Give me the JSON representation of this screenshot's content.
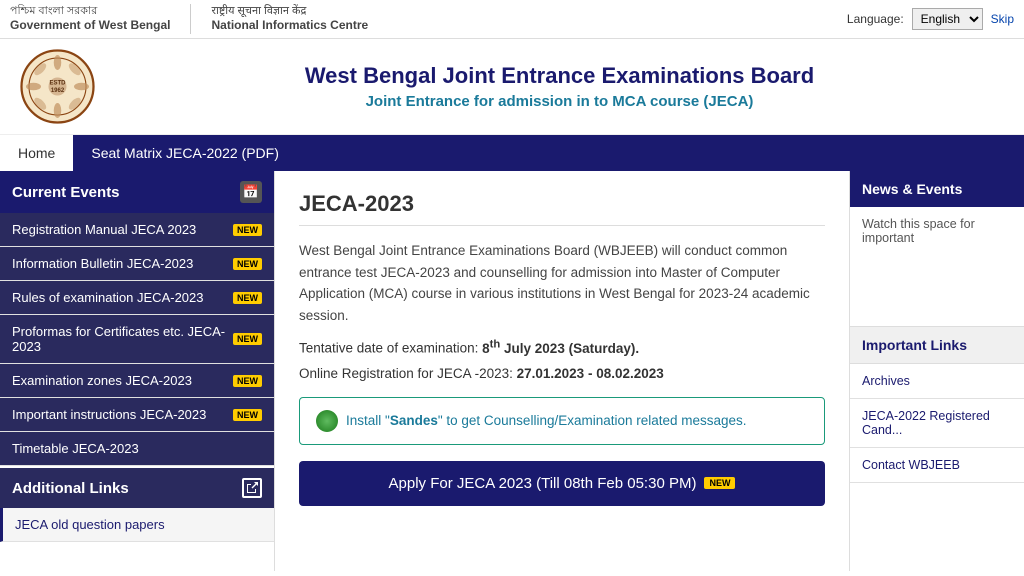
{
  "govBar": {
    "org1": {
      "line1": "পশ্চিম বাংলা সরকার",
      "line2": "Government of West Bengal"
    },
    "org2": {
      "line1": "राष्ट्रीय सूचना विज्ञान केंद्र",
      "line2": "National Informatics Centre"
    },
    "languageLabel": "Language:",
    "languageValue": "English",
    "skipLabel": "Skip"
  },
  "header": {
    "title": "West Bengal Joint Entrance Examinations Board",
    "subtitle": "Joint Entrance for admission in to MCA course (JECA)"
  },
  "nav": {
    "items": [
      {
        "label": "Home",
        "active": true
      },
      {
        "label": "Seat Matrix JECA-2022 (PDF)",
        "active": false
      }
    ]
  },
  "sidebar": {
    "currentEventsLabel": "Current Events",
    "items": [
      {
        "label": "Registration Manual JECA 2023",
        "hasNew": true
      },
      {
        "label": "Information Bulletin JECA-2023",
        "hasNew": true
      },
      {
        "label": "Rules of examination JECA-2023",
        "hasNew": true
      },
      {
        "label": "Proformas for Certificates etc. JECA-2023",
        "hasNew": true
      },
      {
        "label": "Examination zones JECA-2023",
        "hasNew": true
      },
      {
        "label": "Important instructions JECA-2023",
        "hasNew": true
      },
      {
        "label": "Timetable JECA-2023",
        "hasNew": false
      }
    ],
    "newBadgeText": "NEW"
  },
  "additionalLinks": {
    "label": "Additional Links",
    "items": [
      {
        "label": "JECA old question papers"
      }
    ]
  },
  "mainContent": {
    "title": "JECA-2023",
    "body": "West Bengal Joint Entrance Examinations Board (WBJEEB) will conduct common entrance test JECA-2023 and counselling for admission into Master of Computer Application (MCA) course in various institutions in West Bengal for 2023-24 academic session.",
    "tentativeLabel": "Tentative date of examination:",
    "tentativeDate": "8",
    "tentativeDateSuperscript": "th",
    "tentativeDateSuffix": " July 2023 (Saturday).",
    "registrationLabel": "Online Registration for JECA -2023:",
    "registrationDates": "27.01.2023 - 08.02.2023",
    "sandesBanner": {
      "prefix": "Install \"",
      "appName": "Sandes",
      "suffix": "\" to get Counselling/Examination related messages."
    },
    "applyButton": {
      "label": "Apply For JECA 2023 (Till 08th Feb 05:30 PM)",
      "badgeText": "NEW"
    }
  },
  "newsEvents": {
    "header": "News & Events",
    "body": "Watch this space for important"
  },
  "importantLinks": {
    "header": "Important Links",
    "items": [
      {
        "label": "Archives"
      },
      {
        "label": "JECA-2022 Registered Cand..."
      },
      {
        "label": "Contact WBJEEB"
      }
    ]
  }
}
